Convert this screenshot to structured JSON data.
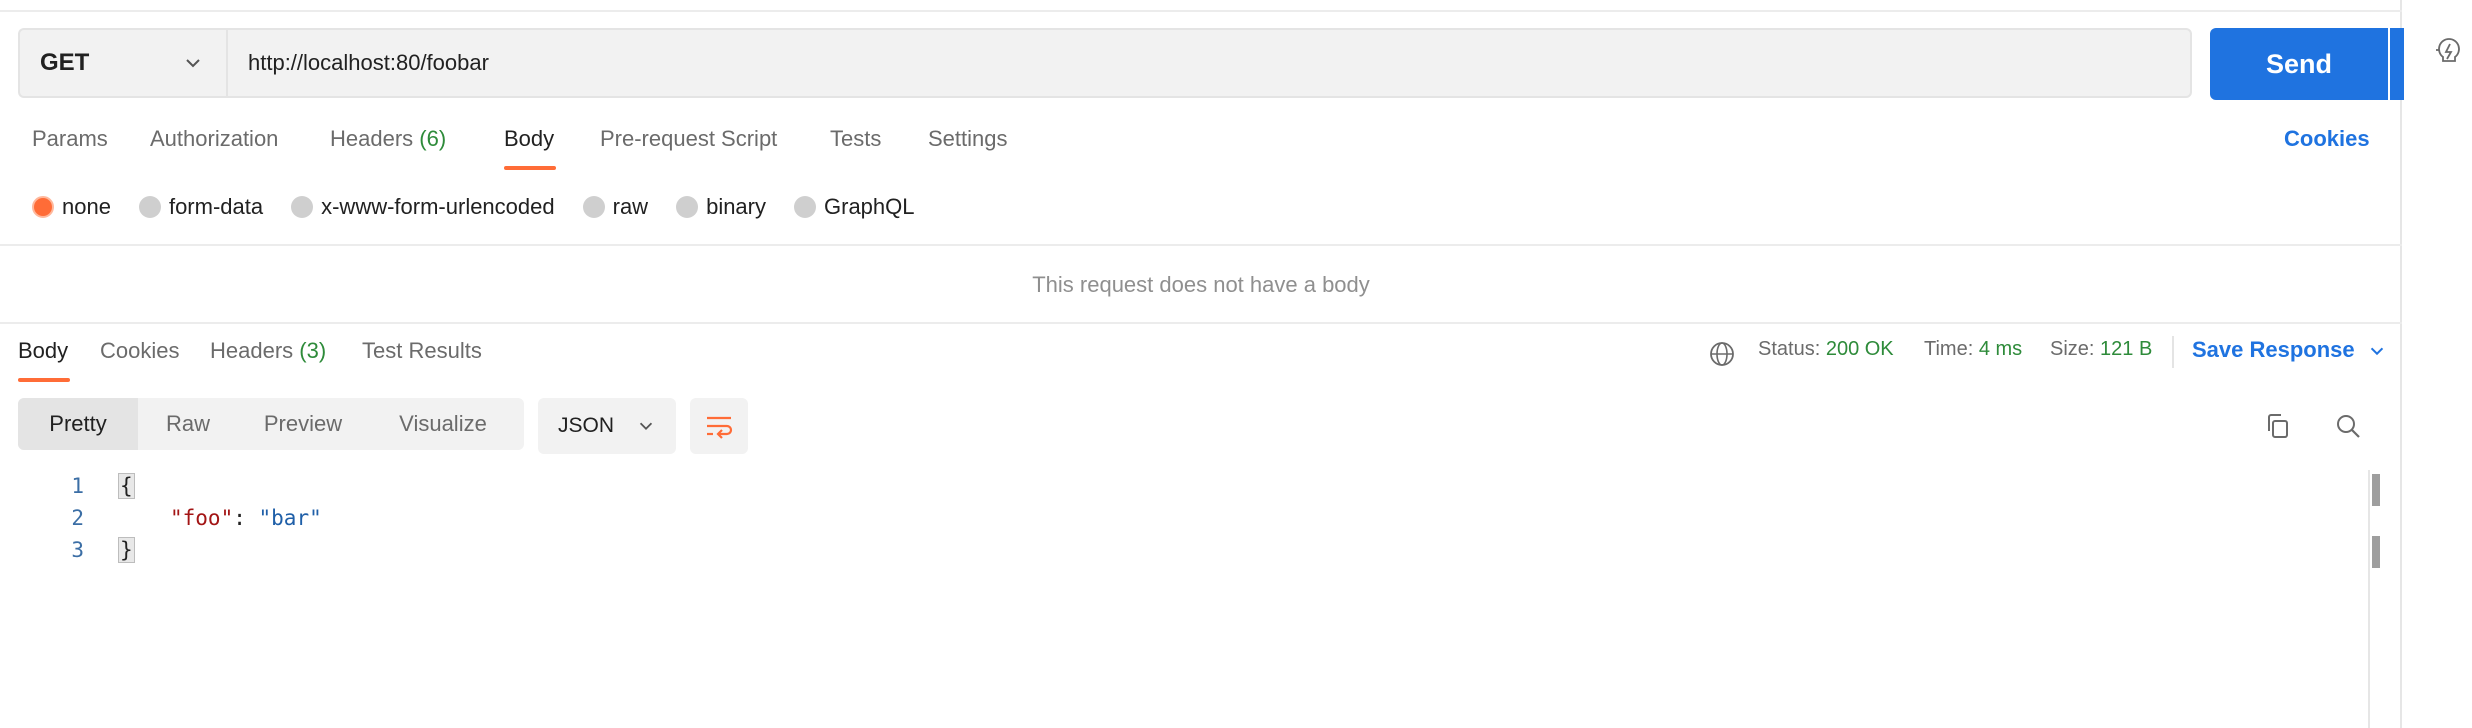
{
  "request": {
    "method": "GET",
    "url": "http://localhost:80/foobar",
    "send_label": "Send"
  },
  "request_tabs": {
    "params": "Params",
    "authorization": "Authorization",
    "headers": "Headers",
    "headers_count": "(6)",
    "body": "Body",
    "prerequest": "Pre-request Script",
    "tests": "Tests",
    "settings": "Settings",
    "cookies": "Cookies"
  },
  "body_types": {
    "none": "none",
    "form_data": "form-data",
    "urlencoded": "x-www-form-urlencoded",
    "raw": "raw",
    "binary": "binary",
    "graphql": "GraphQL",
    "selected": "none"
  },
  "no_body_message": "This request does not have a body",
  "response_tabs": {
    "body": "Body",
    "cookies": "Cookies",
    "headers": "Headers",
    "headers_count": "(3)",
    "test_results": "Test Results"
  },
  "response_status": {
    "status_label": "Status:",
    "status_value": "200 OK",
    "time_label": "Time:",
    "time_value": "4 ms",
    "size_label": "Size:",
    "size_value": "121 B",
    "save_response": "Save Response"
  },
  "view_modes": {
    "pretty": "Pretty",
    "raw": "Raw",
    "preview": "Preview",
    "visualize": "Visualize",
    "format": "JSON"
  },
  "code": {
    "line_numbers": [
      "1",
      "2",
      "3"
    ],
    "open_brace": "{",
    "key": "\"foo\"",
    "colon": ": ",
    "value": "\"bar\"",
    "close_brace": "}"
  },
  "colors": {
    "accent_orange": "#ff6c37",
    "primary_blue": "#1f73e0",
    "success_green": "#2e8b3a"
  }
}
